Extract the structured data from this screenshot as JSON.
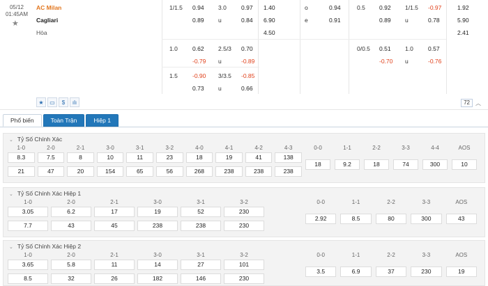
{
  "match": {
    "date": "05/12",
    "time": "01:45AM",
    "home": "AC Milan",
    "away": "Cagliari",
    "draw": "Hòa"
  },
  "odds": {
    "row1": {
      "hcp_line": "1/1.5",
      "hcp_home": "0.94",
      "hcp_away": "0.89",
      "ou_line": "3.0",
      "ou_over": "0.97",
      "ou_u": "u",
      "ou_under": "0.84",
      "x_home": "1.40",
      "x_away": "6.90",
      "x_draw": "4.50",
      "oe_o": "o",
      "oe_odd": "0.94",
      "oe_e": "e",
      "oe_even": "0.91",
      "h1_line": "0.5",
      "h1_home": "0.92",
      "h1_away": "0.89",
      "h1ou_line": "1/1.5",
      "h1ou_over": "-0.97",
      "h1ou_u": "u",
      "h1ou_under": "0.78",
      "h1x_home": "1.92",
      "h1x_away": "5.90",
      "h1x_draw": "2.41"
    },
    "row2": {
      "hcp_line": "1.0",
      "hcp_home": "0.62",
      "hcp_away": "-0.79",
      "ou_line": "2.5/3",
      "ou_over": "0.70",
      "ou_u": "u",
      "ou_under": "-0.89",
      "h1_line": "0/0.5",
      "h1_home": "0.51",
      "h1_away": "-0.70",
      "h1ou_line": "1.0",
      "h1ou_over": "0.57",
      "h1ou_u": "u",
      "h1ou_under": "-0.76"
    },
    "row3": {
      "hcp_line": "1.5",
      "hcp_home": "-0.90",
      "hcp_away": "0.73",
      "ou_line": "3/3.5",
      "ou_over": "-0.85",
      "ou_u": "u",
      "ou_under": "0.66"
    }
  },
  "toolbar": {
    "more_count": "72"
  },
  "tabs": [
    "Phổ biến",
    "Toàn Trận",
    "Hiệp 1"
  ],
  "sections": [
    {
      "title": "Tỷ Số Chính Xác",
      "home_headers": [
        "1-0",
        "2-0",
        "2-1",
        "3-0",
        "3-1",
        "3-2",
        "4-0",
        "4-1",
        "4-2",
        "4-3"
      ],
      "home_values": [
        "8.3",
        "7.5",
        "8",
        "10",
        "11",
        "23",
        "18",
        "19",
        "41",
        "138"
      ],
      "away_values": [
        "21",
        "47",
        "20",
        "154",
        "65",
        "56",
        "268",
        "238",
        "238",
        "238"
      ],
      "draw_headers": [
        "0-0",
        "1-1",
        "2-2",
        "3-3",
        "4-4",
        "AOS"
      ],
      "draw_values": [
        "18",
        "9.2",
        "18",
        "74",
        "300",
        "10"
      ]
    },
    {
      "title": "Tỷ Số Chính Xác Hiệp 1",
      "home_headers": [
        "1-0",
        "2-0",
        "2-1",
        "3-0",
        "3-1",
        "3-2"
      ],
      "home_values": [
        "3.05",
        "6.2",
        "17",
        "19",
        "52",
        "230"
      ],
      "away_values": [
        "7.7",
        "43",
        "45",
        "238",
        "238",
        "230"
      ],
      "draw_headers": [
        "0-0",
        "1-1",
        "2-2",
        "3-3",
        "AOS"
      ],
      "draw_values": [
        "2.92",
        "8.5",
        "80",
        "300",
        "43"
      ]
    },
    {
      "title": "Tỷ Số Chính Xác Hiệp 2",
      "home_headers": [
        "1-0",
        "2-0",
        "2-1",
        "3-0",
        "3-1",
        "3-2"
      ],
      "home_values": [
        "3.65",
        "5.8",
        "11",
        "14",
        "27",
        "101"
      ],
      "away_values": [
        "8.5",
        "32",
        "26",
        "182",
        "146",
        "230"
      ],
      "draw_headers": [
        "0-0",
        "1-1",
        "2-2",
        "3-3",
        "AOS"
      ],
      "draw_values": [
        "3.5",
        "6.9",
        "37",
        "230",
        "19"
      ]
    }
  ]
}
